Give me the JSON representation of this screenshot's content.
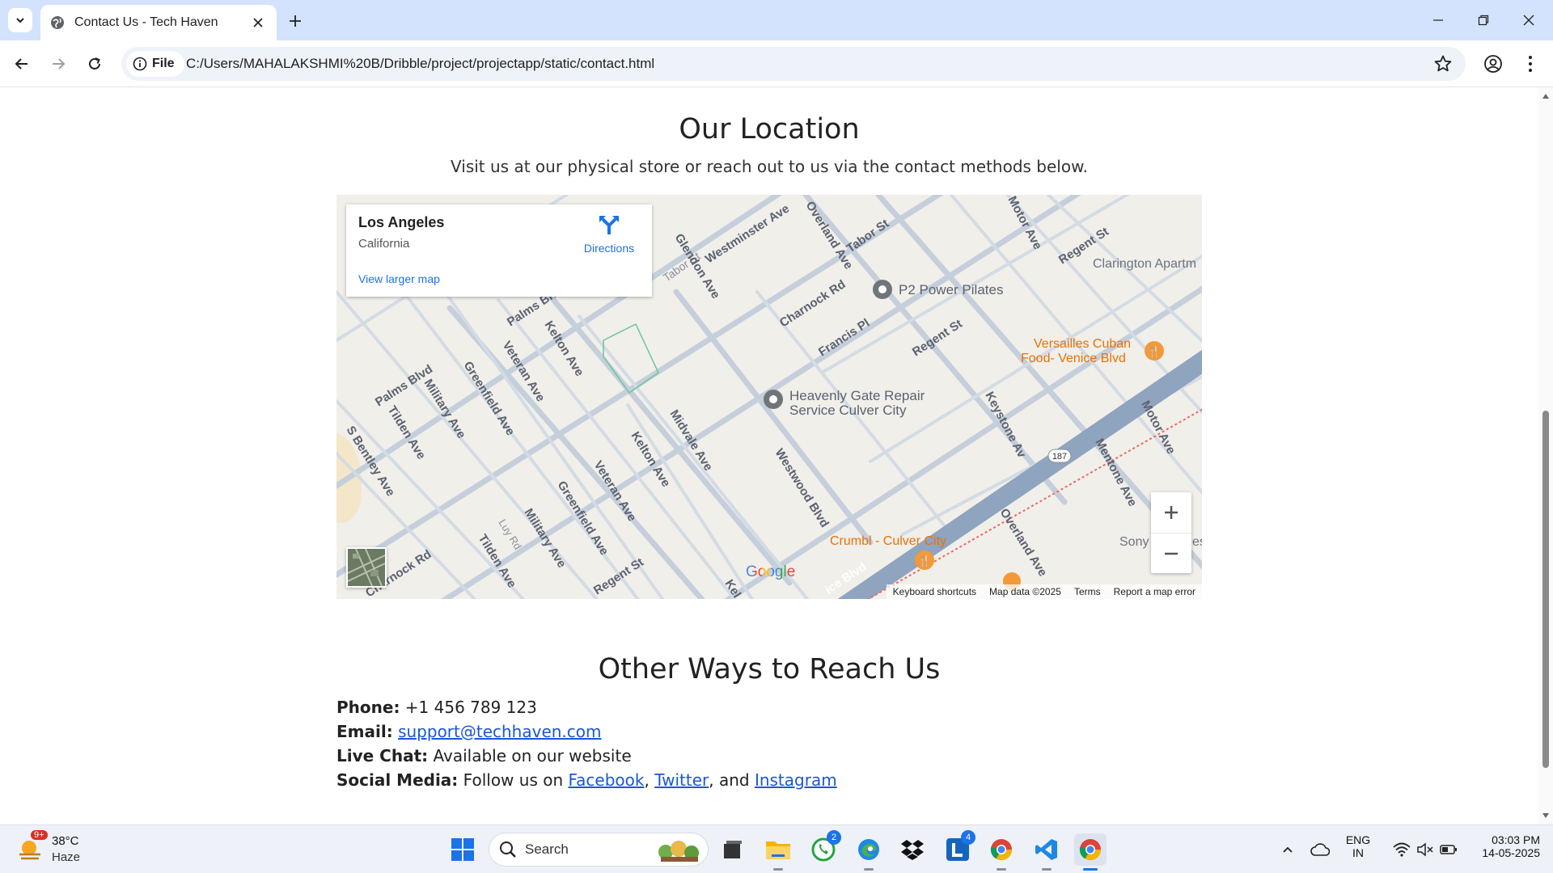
{
  "browser": {
    "tab_title": "Contact Us - Tech Haven",
    "chip_label": "File",
    "url": "C:/Users/MAHALAKSHMI%20B/Dribble/project/projectapp/static/contact.html"
  },
  "page": {
    "location_heading": "Our Location",
    "location_subtitle": "Visit us at our physical store or reach out to us via the contact methods below.",
    "other_heading": "Other Ways to Reach Us",
    "contact": {
      "phone_label": "Phone:",
      "phone_value": "+1 456 789 123",
      "email_label": "Email:",
      "email_value": "support@techhaven.com",
      "chat_label": "Live Chat:",
      "chat_value": "Available on our website",
      "social_label": "Social Media:",
      "social_prefix": "Follow us on",
      "facebook": "Facebook",
      "twitter": "Twitter",
      "and_text": ", and",
      "instagram": "Instagram"
    }
  },
  "map": {
    "place_name": "Los Angeles",
    "region": "California",
    "directions_label": "Directions",
    "larger_map_label": "View larger map",
    "google_label": "Google",
    "footer": {
      "shortcuts": "Keyboard shortcuts",
      "map_data": "Map data ©2025",
      "terms": "Terms",
      "report": "Report a map error"
    },
    "pois": {
      "pilates": "P2 Power Pilates",
      "repair_1": "Heavenly Gate Repair",
      "repair_2": "Service Culver City",
      "versailles_1": "Versailles Cuban",
      "versailles_2": "Food- Venice Blvd",
      "crumbl": "Crumbl - Culver City",
      "clarington": "Clarington Apartm",
      "sony": "Sony",
      "es": "es"
    },
    "streets": {
      "westminster": "Westminster Ave",
      "tabor_1": "Tabor St",
      "tabor_2": "Tabor St",
      "overland_1": "Overland Ave",
      "overland_2": "Overland Ave",
      "motor_1": "Motor Ave",
      "motor_2": "Motor Ave",
      "regent_1": "Regent St",
      "regent_2": "Regent St",
      "regent_3": "Regent St",
      "glendon": "Glendon Ave",
      "charnock_1": "Charnock Rd",
      "charnock_2": "Charnock Rd",
      "francis": "Francis Pl",
      "palms_1": "Palms Blvd",
      "palms_2": "Palms Blvd",
      "kelton_1": "Kelton Ave",
      "kelton_2": "Kelton Ave",
      "kelton_3": "Kel",
      "veteran_1": "Veteran Ave",
      "veteran_2": "Veteran Ave",
      "greenfield_1": "Greenfield Ave",
      "greenfield_2": "Greenfield Ave",
      "military_1": "Military Ave",
      "military_2": "Military Ave",
      "tilden_1": "Tilden Ave",
      "tilden_2": "Tilden Ave",
      "bentley": "S Bentley Ave",
      "midvale": "Midvale Ave",
      "westwood": "Westwood Blvd",
      "keystone": "Keystone Av",
      "mentone": "Mentone Ave",
      "luy": "Luy Rd",
      "venice": "ice Blvd",
      "route": "187"
    }
  },
  "taskbar": {
    "weather_temp": "38°C",
    "weather_cond": "Haze",
    "weather_badge": "9+",
    "search_label": "Search",
    "whatsapp_badge": "2",
    "l_badge": "4",
    "lang_1": "ENG",
    "lang_2": "IN",
    "time": "03:03 PM",
    "date": "14-05-2025"
  },
  "colors": {
    "tabbar_bg": "#d3e3fd",
    "link": "#1a57d6",
    "map_bg": "#f1efea",
    "highway": "#8fa4bf",
    "poi_orange": "#e8710a",
    "poi_gray": "#70757a"
  }
}
